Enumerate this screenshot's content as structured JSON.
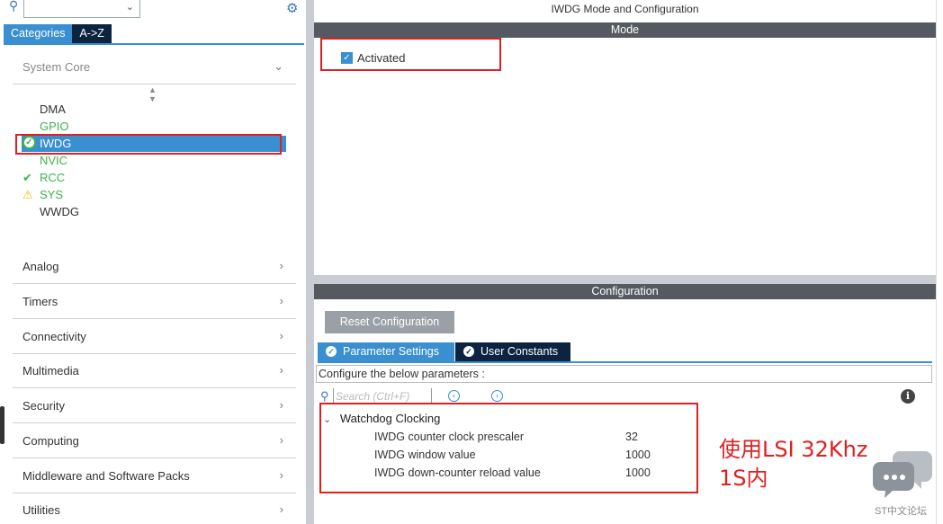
{
  "left_panel": {
    "tabs": [
      "Categories",
      "A->Z"
    ],
    "system_core_label": "System Core",
    "core_items": [
      {
        "label": "DMA",
        "status": "none"
      },
      {
        "label": "GPIO",
        "status": "ok"
      },
      {
        "label": "IWDG",
        "status": "selected"
      },
      {
        "label": "NVIC",
        "status": "ok"
      },
      {
        "label": "RCC",
        "status": "check"
      },
      {
        "label": "SYS",
        "status": "warning"
      },
      {
        "label": "WWDG",
        "status": "none"
      }
    ],
    "categories": [
      "Analog",
      "Timers",
      "Connectivity",
      "Multimedia",
      "Security",
      "Computing",
      "Middleware and Software Packs",
      "Utilities"
    ]
  },
  "right_panel": {
    "title": "IWDG Mode and Configuration",
    "mode_header": "Mode",
    "activated_label": "Activated",
    "configuration_header": "Configuration",
    "reset_button": "Reset Configuration",
    "tabs": [
      "Parameter Settings",
      "User Constants"
    ],
    "configure_text": "Configure the below parameters :",
    "search_placeholder": "Search (Ctrl+F)",
    "group_label": "Watchdog Clocking",
    "parameters": [
      {
        "name": "IWDG counter clock prescaler",
        "value": "32"
      },
      {
        "name": "IWDG window value",
        "value": "1000"
      },
      {
        "name": "IWDG down-counter reload value",
        "value": "1000"
      }
    ]
  },
  "annotation": {
    "line1": "使用LSI 32Khz",
    "line2": "1S内"
  },
  "watermark": "ST中文论坛",
  "colors": {
    "accent": "#3a8fd0",
    "dark_tab": "#0c2440",
    "highlight_red": "#e02020",
    "ok_green": "#3cb44b",
    "warning": "#f0c000"
  }
}
